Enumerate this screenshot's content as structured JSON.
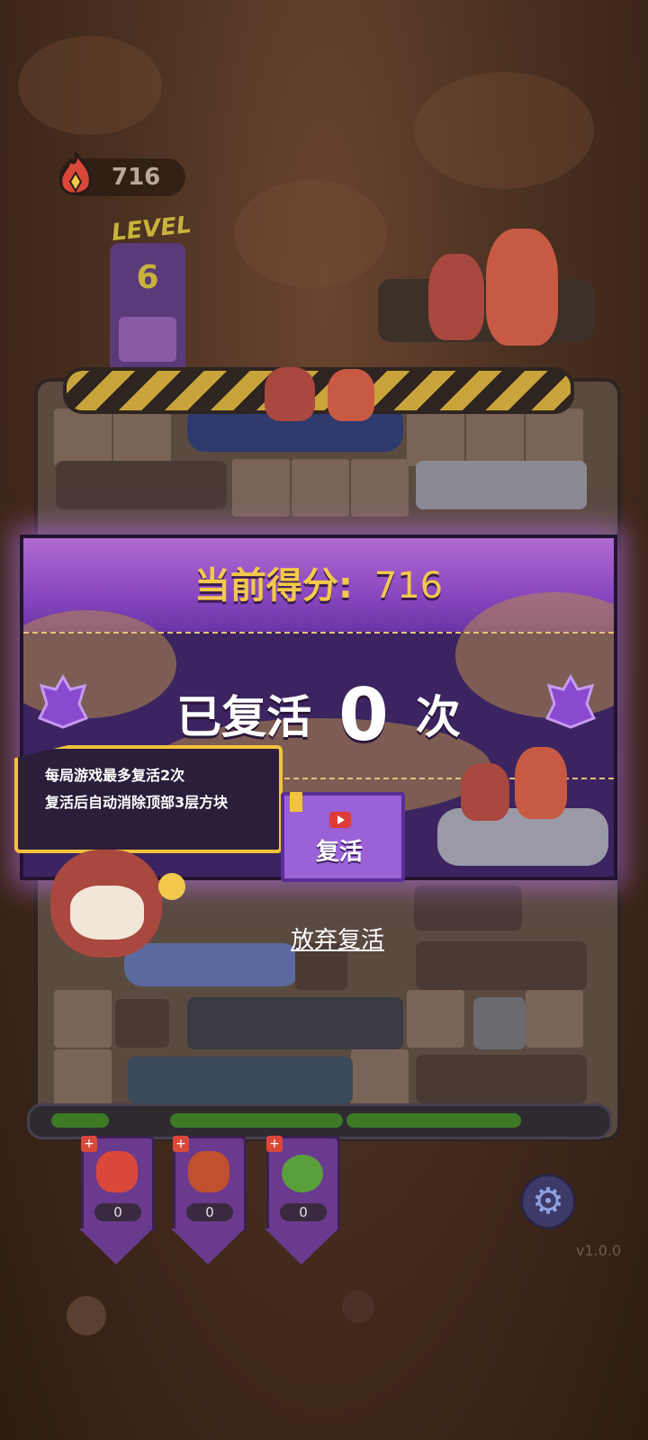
{
  "hud": {
    "score": "716",
    "level_label": "LEVEL",
    "level_number": "6"
  },
  "dialog": {
    "score_label": "当前得分:",
    "score_value": "716",
    "revived_prefix": "已复活",
    "revived_count": "0",
    "revived_suffix": "次",
    "tooltip_lines": [
      "每局游戏最多复活2次",
      "复活后自动消除顶部3层方块"
    ],
    "revive_button": "复活",
    "give_up": "放弃复活"
  },
  "tools": [
    {
      "icon": "fire-tool-icon",
      "count": "0",
      "color": "#d9483a"
    },
    {
      "icon": "bear-tool-icon",
      "count": "0",
      "color": "#c0502e"
    },
    {
      "icon": "slime-tool-icon",
      "count": "0",
      "color": "#5aa03a"
    }
  ],
  "footer": {
    "version": "v1.0.0"
  },
  "colors": {
    "accent_gold": "#f2c94c",
    "dialog_purple": "#3b2460",
    "button_purple": "#9a62d6"
  }
}
